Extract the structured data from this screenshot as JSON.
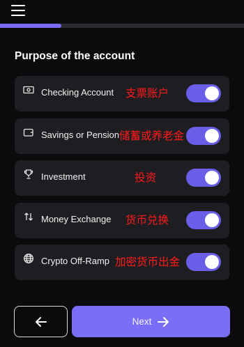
{
  "header": {
    "menu_icon": "hamburger-menu-icon"
  },
  "progress": {
    "fraction": 0.25,
    "fill_color": "#7a6cf4",
    "track_color": "#2a2a31"
  },
  "title": "Purpose of the account",
  "options": [
    {
      "label": "Checking Account",
      "note": "支票账户",
      "icon": "banknote-icon",
      "enabled": true
    },
    {
      "label": "Savings or Pension",
      "note": "储蓄或养老金",
      "icon": "wallet-icon",
      "enabled": true
    },
    {
      "label": "Investment",
      "note": "投资",
      "icon": "trophy-icon",
      "enabled": true
    },
    {
      "label": "Money Exchange",
      "note": "货币兑换",
      "icon": "exchange-arrows-icon",
      "enabled": true
    },
    {
      "label": "Crypto Off-Ramp",
      "note": "加密货币出金",
      "icon": "globe-icon",
      "enabled": true
    }
  ],
  "footer": {
    "back_icon": "arrow-left-icon",
    "next_label": "Next",
    "next_icon": "arrow-right-icon"
  },
  "colors": {
    "accent": "#7b6ef6",
    "toggle_on": "#6a5ee8",
    "card": "#1e1e22",
    "background": "#0b0b0d",
    "annotation": "#ff1a1a"
  }
}
